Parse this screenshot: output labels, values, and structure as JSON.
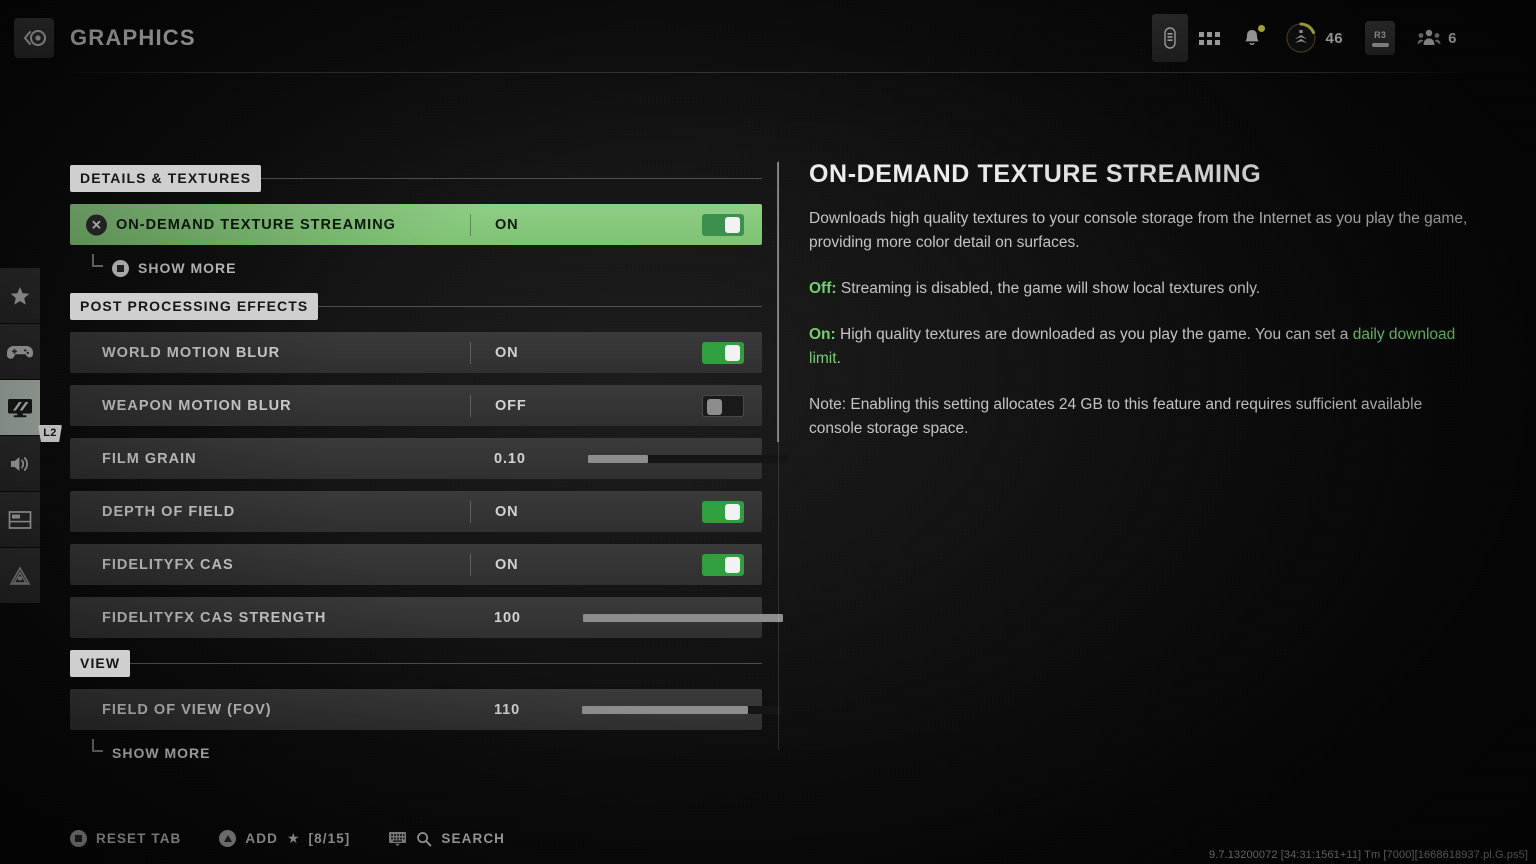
{
  "header": {
    "title": "GRAPHICS",
    "back_icon": "back-circle-icon",
    "battery_icon": "battery-icon",
    "apps_icon": "apps-grid-icon",
    "bell_icon": "notification-bell-icon",
    "rank_icon": "rank-chevron-icon",
    "rank_value": "46",
    "r3_label": "R3",
    "party_icon": "party-members-icon",
    "party_count": "6"
  },
  "rail": {
    "items": [
      {
        "name": "favorites",
        "icon": "star-icon",
        "active": false
      },
      {
        "name": "controller",
        "icon": "gamepad-icon",
        "active": false
      },
      {
        "name": "graphics",
        "icon": "monitor-icon",
        "active": true
      },
      {
        "name": "audio",
        "icon": "speaker-icon",
        "active": false
      },
      {
        "name": "interface",
        "icon": "layout-icon",
        "active": false
      },
      {
        "name": "account",
        "icon": "network-icon",
        "active": false
      }
    ],
    "badge": "L2"
  },
  "settings": {
    "sections": [
      {
        "title": "DETAILS & TEXTURES",
        "rows": [
          {
            "label": "ON-DEMAND TEXTURE STREAMING",
            "value": "ON",
            "control": "toggle",
            "toggle_state": "on",
            "selected": true,
            "badge_icon": "playstation-cross-icon",
            "badge_glyph": "✕"
          }
        ],
        "show_more": {
          "label": "SHOW MORE",
          "has_icon": true
        }
      },
      {
        "title": "POST PROCESSING EFFECTS",
        "rows": [
          {
            "label": "WORLD MOTION BLUR",
            "value": "ON",
            "control": "toggle",
            "toggle_state": "on",
            "selected": false
          },
          {
            "label": "WEAPON MOTION BLUR",
            "value": "OFF",
            "control": "toggle",
            "toggle_state": "off",
            "selected": false
          },
          {
            "label": "FILM GRAIN",
            "value": "0.10",
            "control": "slider",
            "slider_percent": 30,
            "selected": false
          },
          {
            "label": "DEPTH OF FIELD",
            "value": "ON",
            "control": "toggle",
            "toggle_state": "on",
            "selected": false
          },
          {
            "label": "FIDELITYFX CAS",
            "value": "ON",
            "control": "toggle",
            "toggle_state": "on",
            "selected": false
          },
          {
            "label": "FIDELITYFX CAS STRENGTH",
            "value": "100",
            "control": "slider",
            "slider_percent": 100,
            "selected": false
          }
        ]
      },
      {
        "title": "VIEW",
        "rows": [
          {
            "label": "FIELD OF VIEW (FOV)",
            "value": "110",
            "control": "slider",
            "slider_percent": 83,
            "selected": false
          }
        ],
        "show_more": {
          "label": "SHOW MORE",
          "has_icon": false
        }
      }
    ]
  },
  "detail": {
    "title": "ON-DEMAND TEXTURE STREAMING",
    "paragraph_1": "Downloads high quality textures to your console storage from the Internet as you play the game, providing more color detail on surfaces.",
    "off_label": "Off:",
    "off_text": " Streaming is disabled, the game will show local textures only.",
    "on_label": "On:",
    "on_text": " High quality textures are downloaded as you play the game. You can set a ",
    "on_link": "daily download limit",
    "on_text_end": ".",
    "note_text": "Note: Enabling this setting allocates 24 GB to this feature and requires sufficient available console storage space."
  },
  "footer": {
    "reset_label": "RESET TAB",
    "add_label": "ADD",
    "add_star": "★",
    "add_count": "[8/15]",
    "search_label": "SEARCH",
    "keyboard_icon": "keyboard-icon",
    "search_icon": "magnifier-icon",
    "version": "9.7.13200072 [34:31:1561+11] Tm [7000][1668618937.pl.G.ps5]"
  },
  "colors": {
    "accent_green": "#8fce86",
    "toggle_green": "#2f9f3f",
    "text_green": "#74d06e",
    "chip_gray": "#cfcfcf"
  }
}
